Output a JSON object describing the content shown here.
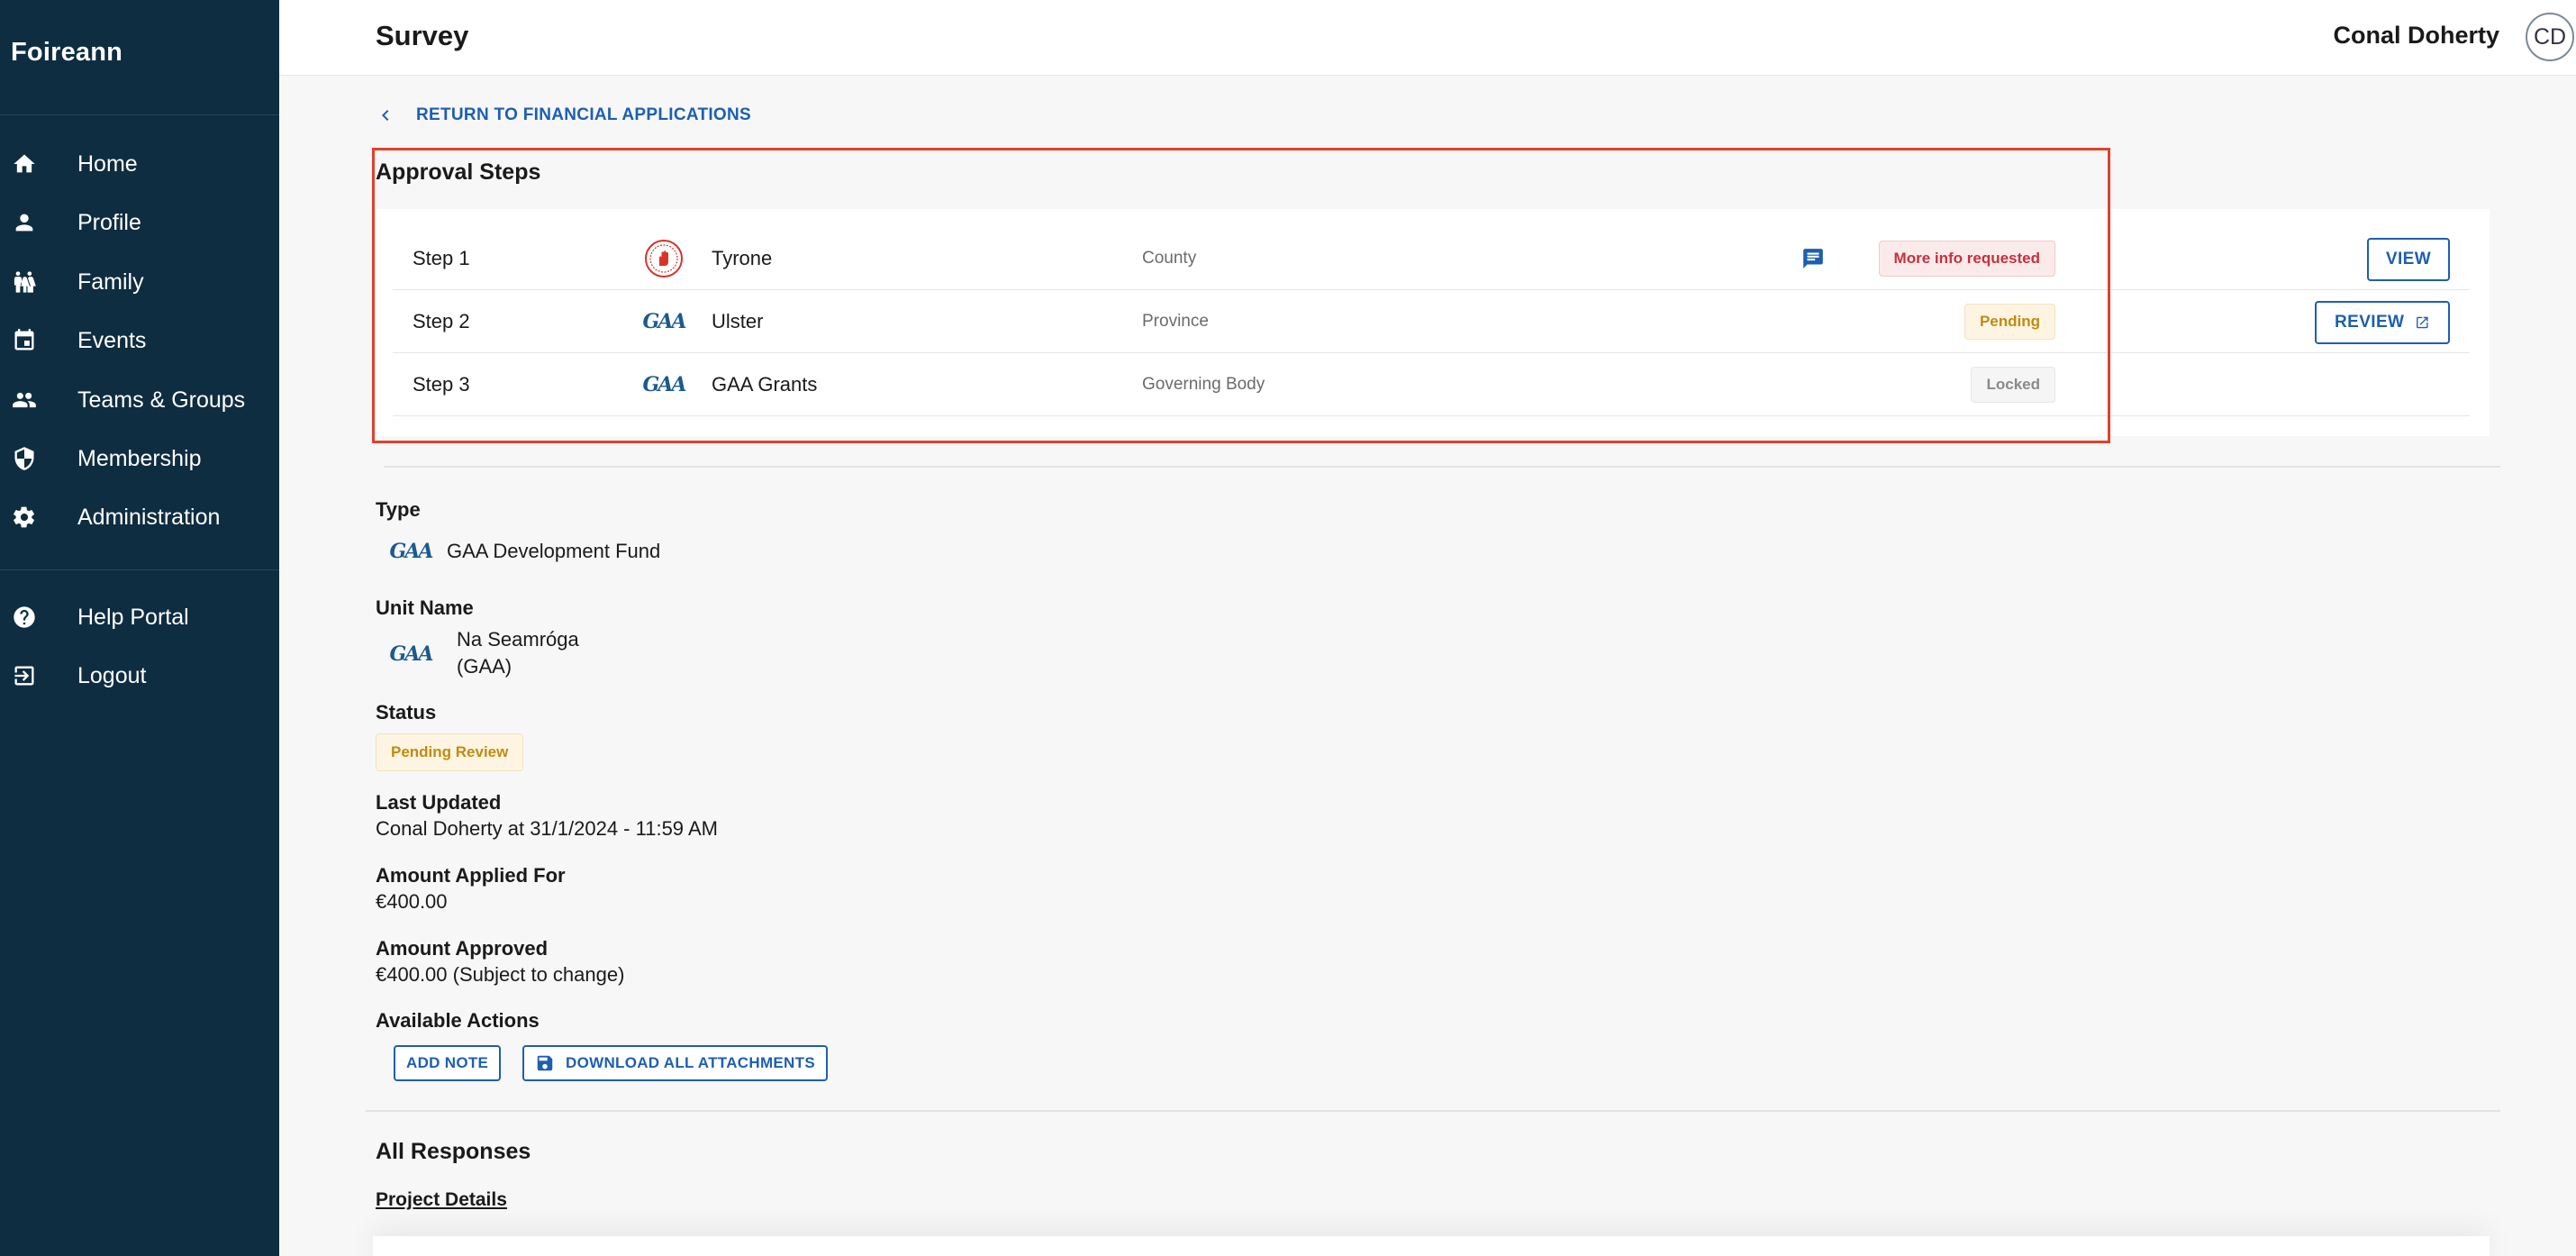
{
  "brand": "Foireann",
  "sidebar": {
    "items": [
      {
        "label": "Home",
        "icon": "home-icon"
      },
      {
        "label": "Profile",
        "icon": "person-icon"
      },
      {
        "label": "Family",
        "icon": "family-icon"
      },
      {
        "label": "Events",
        "icon": "calendar-icon"
      },
      {
        "label": "Teams & Groups",
        "icon": "groups-icon"
      },
      {
        "label": "Membership",
        "icon": "shield-icon"
      },
      {
        "label": "Administration",
        "icon": "gear-icon"
      }
    ],
    "footer_items": [
      {
        "label": "Help Portal",
        "icon": "help-icon"
      },
      {
        "label": "Logout",
        "icon": "logout-icon"
      }
    ]
  },
  "header": {
    "title": "Survey",
    "user_name": "Conal Doherty",
    "avatar_initials": "CD"
  },
  "back_link": "RETURN TO FINANCIAL APPLICATIONS",
  "approval": {
    "title": "Approval Steps",
    "steps": [
      {
        "step": "Step 1",
        "name": "Tyrone",
        "level": "County",
        "status": "More info requested",
        "action": "VIEW",
        "logo": "tyrone-crest"
      },
      {
        "step": "Step 2",
        "name": "Ulster",
        "level": "Province",
        "status": "Pending",
        "action": "REVIEW",
        "logo": "gaa-logo"
      },
      {
        "step": "Step 3",
        "name": "GAA Grants",
        "level": "Governing Body",
        "status": "Locked",
        "action": "",
        "logo": "gaa-logo"
      }
    ]
  },
  "logo_text": "GAA",
  "details": {
    "type_label": "Type",
    "type_value": "GAA Development Fund",
    "unit_label": "Unit Name",
    "unit_value_line1": "Na Seamróga",
    "unit_value_line2": "(GAA)",
    "status_label": "Status",
    "status_value": "Pending Review",
    "last_updated_label": "Last Updated",
    "last_updated_value": "Conal Doherty at 31/1/2024 - 11:59 AM",
    "applied_label": "Amount Applied For",
    "applied_value": "€400.00",
    "approved_label": "Amount Approved",
    "approved_value": "€400.00 (Subject to change)",
    "actions_label": "Available Actions",
    "add_note": "ADD NOTE",
    "download_all": "DOWNLOAD ALL ATTACHMENTS"
  },
  "responses": {
    "title": "All Responses",
    "section": "Project Details"
  },
  "colors": {
    "sidebar_bg": "#0f2d40",
    "accent": "#1d5fb0",
    "highlight": "#e2402a",
    "status_red": "#c2333c",
    "status_yellow": "#c18b12"
  }
}
